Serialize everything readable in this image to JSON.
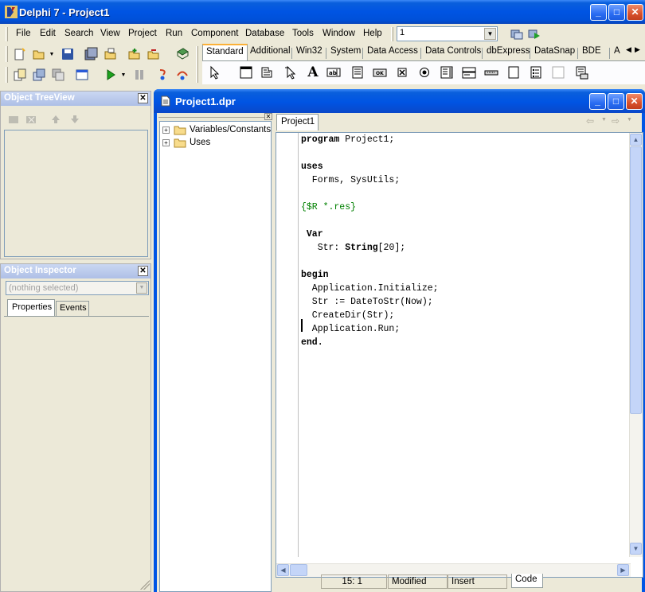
{
  "window": {
    "title": "Delphi 7 - Project1"
  },
  "menu": [
    "File",
    "Edit",
    "Search",
    "View",
    "Project",
    "Run",
    "Component",
    "Database",
    "Tools",
    "Window",
    "Help"
  ],
  "desktop_combo": {
    "value": "1"
  },
  "palette_tabs": [
    "Standard",
    "Additional",
    "Win32",
    "System",
    "Data Access",
    "Data Controls",
    "dbExpress",
    "DataSnap",
    "BDE",
    "A"
  ],
  "treeview": {
    "title": "Object TreeView"
  },
  "inspector": {
    "title": "Object Inspector",
    "selector_placeholder": "(nothing selected)",
    "tabs": [
      "Properties",
      "Events"
    ]
  },
  "editor": {
    "title": "Project1.dpr",
    "tab": "Project1",
    "explorer_items": [
      "Variables/Constants",
      "Uses"
    ],
    "code_lines": [
      {
        "kw": "program",
        "rest": " Project1;"
      },
      {
        "kw": "",
        "rest": ""
      },
      {
        "kw": "uses",
        "rest": ""
      },
      {
        "kw": "",
        "rest": "  Forms, SysUtils;"
      },
      {
        "kw": "",
        "rest": ""
      },
      {
        "cm": "{$R *.res}"
      },
      {
        "kw": "",
        "rest": ""
      },
      {
        "kw": " Var",
        "rest": ""
      },
      {
        "mixed": [
          "   Str: ",
          "String",
          "[20];"
        ]
      },
      {
        "kw": "",
        "rest": ""
      },
      {
        "kw": "begin",
        "rest": ""
      },
      {
        "kw": "",
        "rest": "  Application.Initialize;"
      },
      {
        "kw": "",
        "rest": "  Str := DateToStr(Now);"
      },
      {
        "kw": "",
        "rest": "  CreateDir(Str);"
      },
      {
        "kw": "",
        "rest": "  Application.Run;"
      },
      {
        "kw": "end.",
        "rest": ""
      }
    ],
    "status": {
      "position": "15:  1",
      "modified": "Modified",
      "mode": "Insert",
      "view_tab": "Code"
    }
  },
  "colors": {
    "titlebar": "#0054e3",
    "comment": "#008000",
    "face": "#ece9d8"
  }
}
